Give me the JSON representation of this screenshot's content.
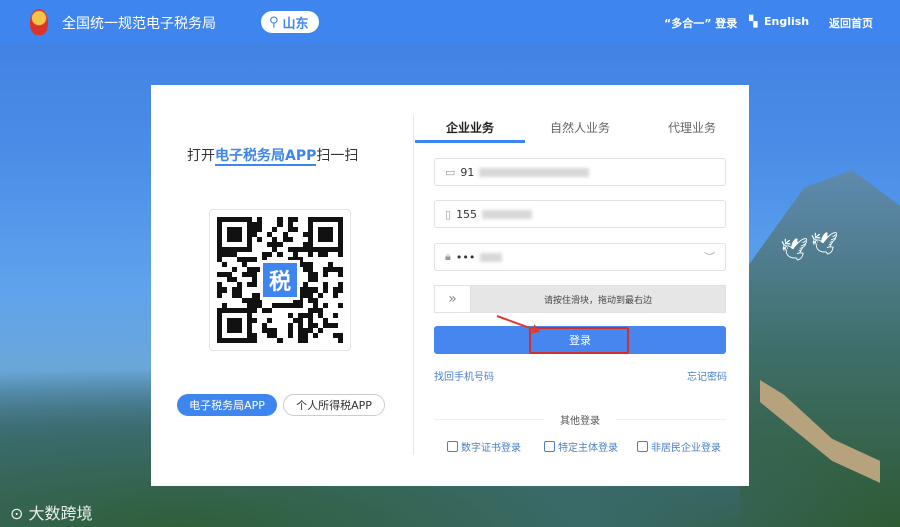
{
  "header": {
    "site_title": "全国统一规范电子税务局",
    "region": "山东",
    "multi_login": "“多合一” 登录",
    "language": "English",
    "home": "返回首页"
  },
  "left": {
    "scan_prefix": "打开",
    "scan_app": "电子税务局APP",
    "scan_suffix": "扫一扫",
    "qr_logo": "税",
    "app_buttons": [
      "电子税务局APP",
      "个人所得税APP"
    ]
  },
  "tabs": [
    "企业业务",
    "自然人业务",
    "代理业务"
  ],
  "form": {
    "tax_id": "91",
    "phone": "155",
    "password": "•••",
    "slider_hint": "请按住滑块，拖动到最右边",
    "login": "登录",
    "recover_phone": "找回手机号码",
    "forgot_password": "忘记密码"
  },
  "other": {
    "title": "其他登录",
    "options": [
      "数字证书登录",
      "特定主体登录",
      "非居民企业登录"
    ]
  },
  "watermark": "大数跨境"
}
